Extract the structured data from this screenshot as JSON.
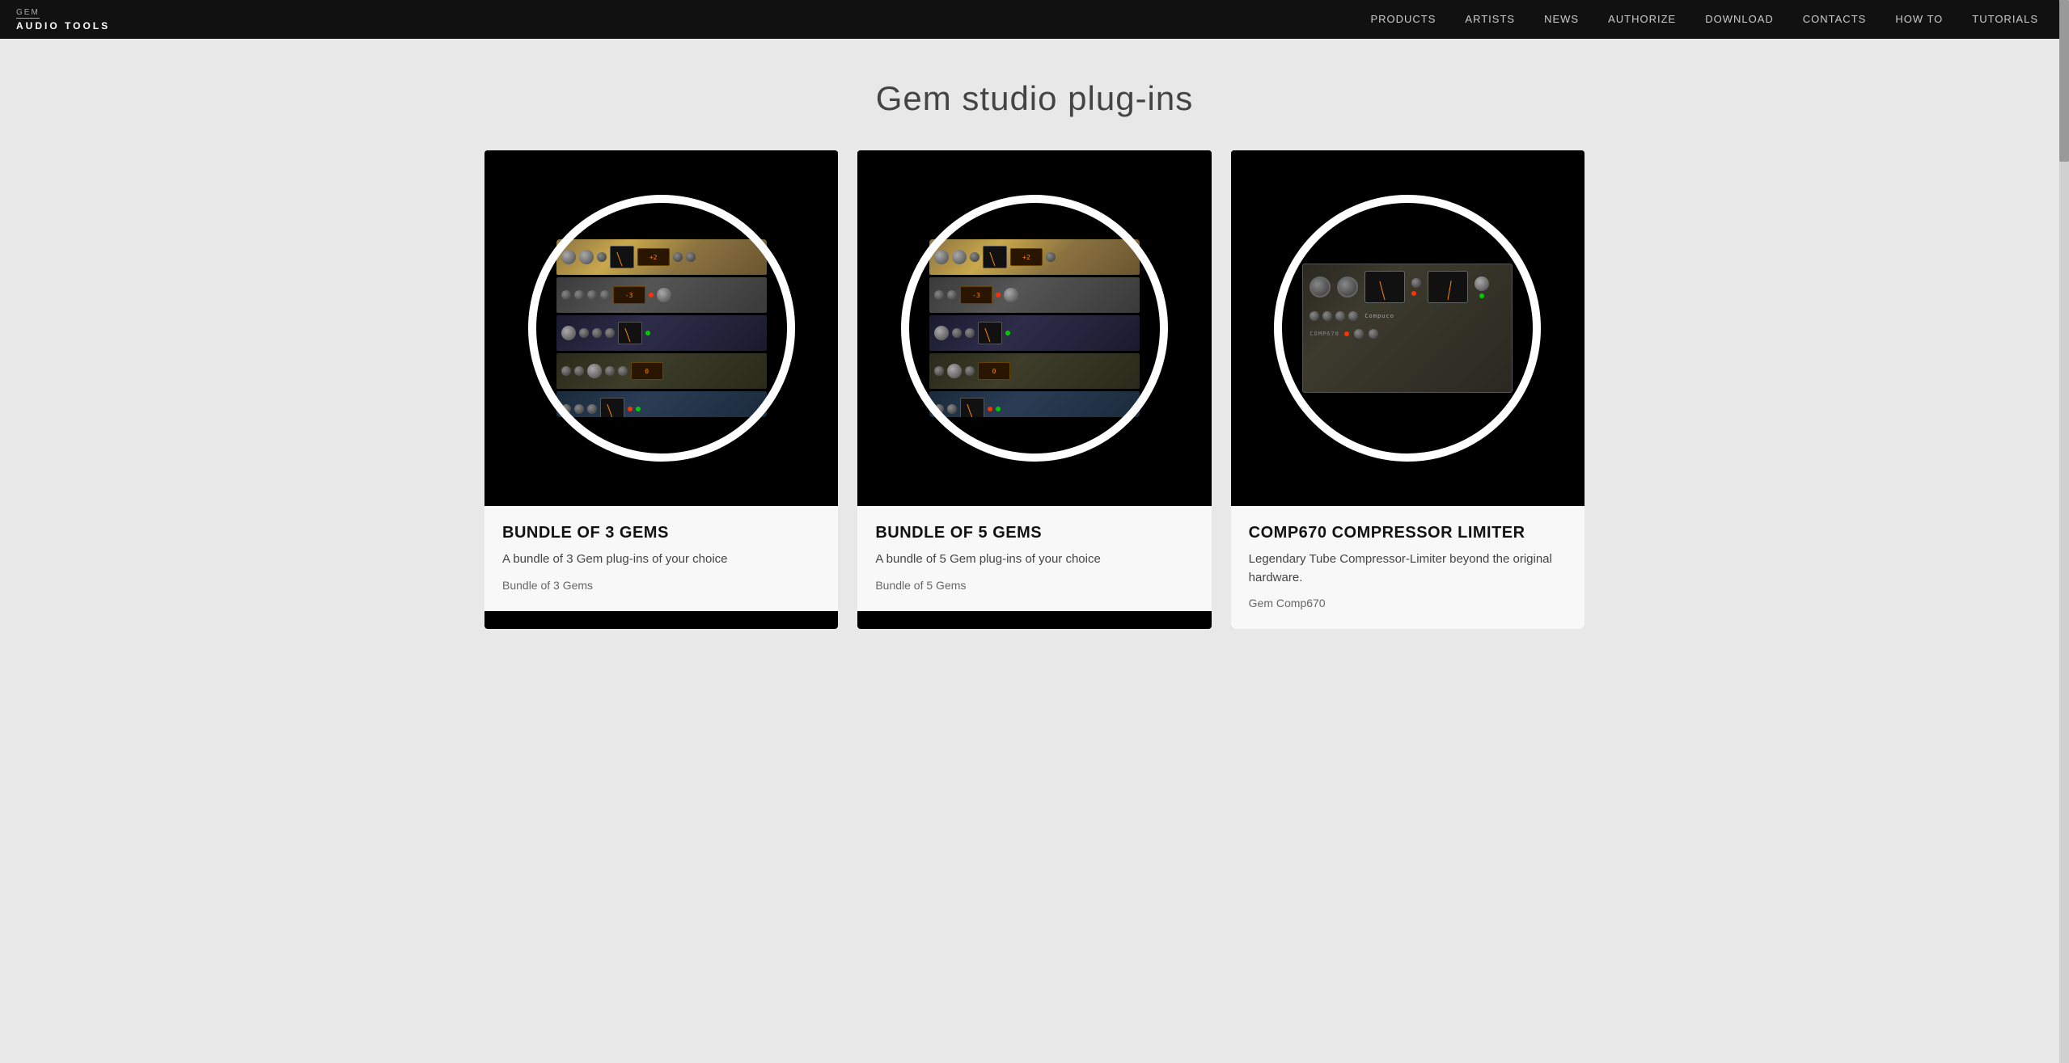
{
  "nav": {
    "logo_top": "GEM",
    "logo_bottom": "AUDIO TOOLS",
    "links": [
      {
        "label": "PRODUCTS",
        "active": true
      },
      {
        "label": "ARTISTS",
        "active": false
      },
      {
        "label": "NEWS",
        "active": false
      },
      {
        "label": "AUTHORIZE",
        "active": false
      },
      {
        "label": "DOWNLOAD",
        "active": false
      },
      {
        "label": "CONTACTS",
        "active": false
      },
      {
        "label": "HOW TO",
        "active": false
      },
      {
        "label": "TUTORIALS",
        "active": false
      }
    ]
  },
  "page": {
    "title": "Gem studio plug-ins"
  },
  "products": [
    {
      "id": "bundle-3",
      "title": "BUNDLE OF 3 GEMS",
      "description": "A bundle of 3 Gem plug-ins of your choice",
      "tag": "Bundle of 3 Gems",
      "type": "bundle3"
    },
    {
      "id": "bundle-5",
      "title": "BUNDLE OF 5 GEMS",
      "description": "A bundle of 5 Gem plug-ins of your choice",
      "tag": "Bundle of 5 Gems",
      "type": "bundle5"
    },
    {
      "id": "comp670",
      "title": "COMP670 COMPRESSOR LIMITER",
      "description": "Legendary Tube Compressor-Limiter beyond the original hardware.",
      "tag": "Gem Comp670",
      "type": "comp670"
    }
  ]
}
